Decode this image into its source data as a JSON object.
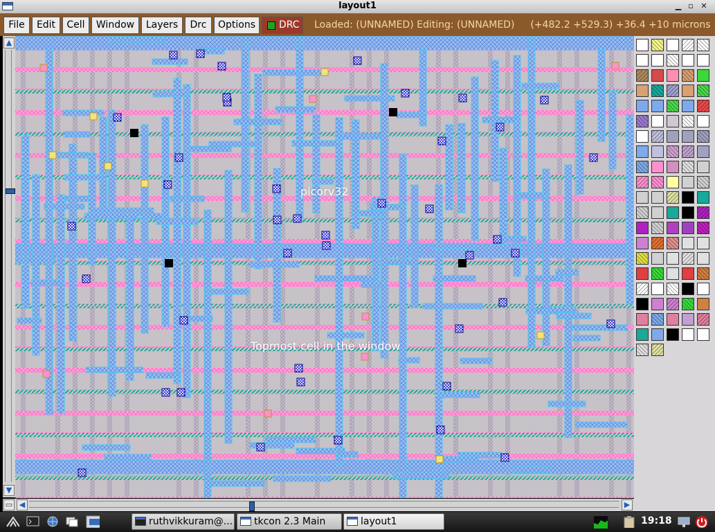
{
  "window": {
    "title": "layout1",
    "controls": {
      "minimize": "▁",
      "maximize": "▫",
      "close": "✕"
    }
  },
  "menu": {
    "items": [
      "File",
      "Edit",
      "Cell",
      "Window",
      "Layers",
      "Drc",
      "Options"
    ],
    "drc_label": "DRC",
    "drc_status_color": "#1fa31f",
    "status_text": "Loaded: (UNNAMED) Editing: (UNNAMED)",
    "coordinates": "(+482.2 +529.3) +36.4 +10 microns"
  },
  "canvas": {
    "labels": {
      "cell_name": "picorv32",
      "topmost_note": "Topmost cell in the window"
    },
    "colors": {
      "background": "#c7c2c7",
      "metal1": "#7ea9ea",
      "metal1_outline": "#4cc9f0",
      "poly": "#ff8fd0",
      "diffusion": "#19a99a",
      "via": "#1717d6",
      "contact": "#000000",
      "local_interconnect": "#a9a9c9"
    }
  },
  "scrollbars": {
    "vertical_up_icon": "arrow-up-icon",
    "vertical_down_icon": "arrow-down-icon",
    "horizontal_left_icon": "arrow-left-icon",
    "horizontal_right_icon": "arrow-right-icon"
  },
  "palette": {
    "colors": [
      "#ffffff",
      "#f5f58a",
      "#ffffff",
      "#ffffff",
      "#ffffff",
      "#ffffff",
      "#ffffff",
      "#ffffff",
      "#ffffff",
      "#ffffff",
      "#b08a5a",
      "#d64a4a",
      "#ff8fb0",
      "#d9a070",
      "#3ad83a",
      "#d9a070",
      "#19a99a",
      "#a0a0d0",
      "#d9a070",
      "#4ad84a",
      "#7ea9ea",
      "#7ea9ea",
      "#4ad84a",
      "#7ea9ea",
      "#e84a4a",
      "#9a7ad0",
      "#ffffff",
      "#d0c8d0",
      "#ffffff",
      "#ffffff",
      "#ffffff",
      "#c0c0e0",
      "#a0a0c0",
      "#a0a0c0",
      "#a0a0c0",
      "#7ea9ea",
      "#c0c0e0",
      "#d0a0d0",
      "#c0a0d0",
      "#a0a0c0",
      "#7ea9ea",
      "#ff8fd0",
      "#d090c0",
      "#e0e0e0",
      "#d0d0d0",
      "#ff8fd0",
      "#ff8fd0",
      "#ffffa0",
      "#d0d0d0",
      "#d0d0d0",
      "#d0d0d0",
      "#d0d0d0",
      "#e0e0a0",
      "#000000",
      "#19a99a",
      "#d0d0d0",
      "#d0d0d0",
      "#19a99a",
      "#000000",
      "#b020c0",
      "#b020c0",
      "#d0d0d0",
      "#b040c0",
      "#a040c0",
      "#c020c0",
      "#d080d0",
      "#e07030",
      "#e09090",
      "#e0e0e0",
      "#e0e0e0",
      "#e0e040",
      "#d0d0d0",
      "#e0e0e0",
      "#e0e0e0",
      "#e0e0e0",
      "#e04040",
      "#3ad83a",
      "#e0e0e0",
      "#e04040",
      "#d08040",
      "#ffffff",
      "#ffffff",
      "#ffffff",
      "#000000",
      "#ffffff",
      "#000000",
      "#d080d0",
      "#d080d0",
      "#3ad83a",
      "#d08040",
      "#e080a0",
      "#7ea9ea",
      "#e080a0",
      "#c0a0d0",
      "#e080a0",
      "#19a99a",
      "#7ea9ea",
      "#000000",
      "#ffffff",
      "#ffffff",
      "#e0e0e0",
      "#e0e0a0"
    ]
  },
  "taskbar": {
    "tasks": [
      {
        "label": "ruthvikkuram@...",
        "icon": "terminal-icon"
      },
      {
        "label": "tkcon 2.3 Main",
        "icon": "window-icon"
      },
      {
        "label": "layout1",
        "icon": "window-icon"
      }
    ],
    "clock": "19:18",
    "launcher_icons": [
      "start-menu-icon",
      "terminal-icon",
      "globe-icon",
      "files-icon",
      "show-desktop-icon"
    ],
    "tray_icons": [
      "cpu-monitor-icon",
      "clipboard-icon",
      "network-icon",
      "power-icon"
    ]
  }
}
